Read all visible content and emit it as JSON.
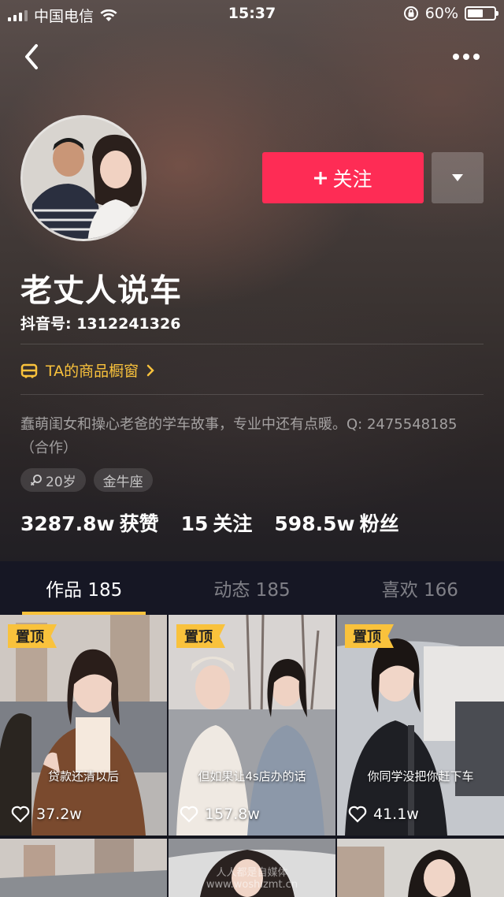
{
  "status_bar": {
    "carrier": "中国电信",
    "time": "15:37",
    "battery": "60%",
    "battery_level": 0.6
  },
  "nav": {
    "back_icon": "chevron-left-icon",
    "more_icon": "more-dots-icon"
  },
  "profile": {
    "name": "老丈人说车",
    "douyin_id": "抖音号: 1312241326",
    "follow_label": "关注",
    "shop_label": "TA的商品橱窗",
    "bio": "蠢萌闺女和操心老爸的学车故事，专业中还有点暖。Q: 2475548185（合作）",
    "tags": [
      "20岁",
      "金牛座"
    ],
    "stats": [
      {
        "value": "3287.8w",
        "label": "获赞"
      },
      {
        "value": "15",
        "label": "关注"
      },
      {
        "value": "598.5w",
        "label": "粉丝"
      }
    ]
  },
  "tabs": [
    {
      "label": "作品 185",
      "active": true
    },
    {
      "label": "动态 185",
      "active": false
    },
    {
      "label": "喜欢 166",
      "active": false
    }
  ],
  "videos": [
    {
      "pinned": "置顶",
      "caption": "贷款还清以后",
      "likes": "37.2w"
    },
    {
      "pinned": "置顶",
      "caption": "但如果让4s店办的话",
      "likes": "157.8w"
    },
    {
      "pinned": "置顶",
      "caption": "你同学没把你赶下车",
      "likes": "41.1w"
    }
  ],
  "watermark": {
    "line1": "人人都是自媒体",
    "line2": "www.woshizmt.cn"
  },
  "colors": {
    "accent_red": "#fe2c55",
    "accent_yellow": "#f9c23c",
    "tab_bg": "#161724"
  }
}
